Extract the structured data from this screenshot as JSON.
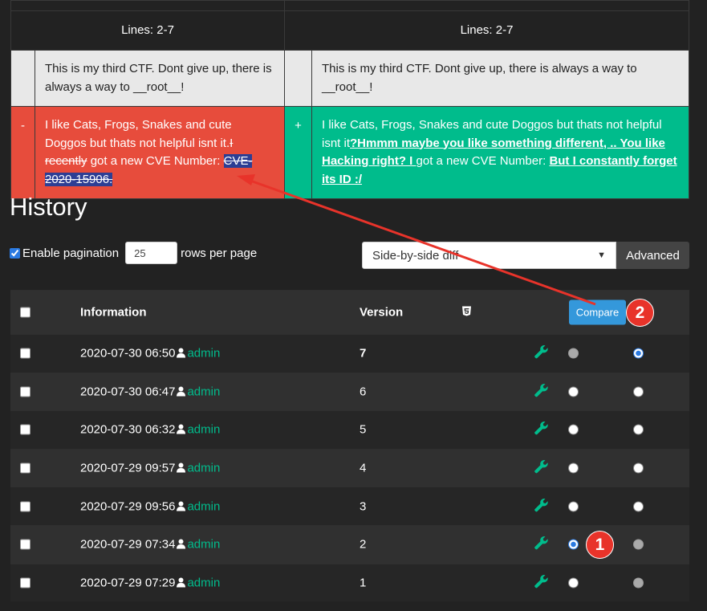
{
  "diff": {
    "lines_left": "Lines: 2-7",
    "lines_right": "Lines: 2-7",
    "context_left": "This is my third CTF. Dont give up, there is always a way to __root__!",
    "context_right": "This is my third CTF. Dont give up, there is always a way to __root__!",
    "del_marker": "-",
    "ins_marker": "+",
    "del_text_1": "I like Cats, Frogs, Snakes and cute Doggos but thats not helpful isnt it.",
    "del_struck": "I recently",
    "del_text_2": " got a new CVE Number: ",
    "del_highlight": "CVE-2020-15906.",
    "ins_text_1": "I like Cats, Frogs, Snakes and cute Doggos but thats not helpful isnt it",
    "ins_added_1": "?Hmmm maybe you like something different, .. You like Hacking right? I ",
    "ins_text_2": "got a new CVE Number: ",
    "ins_added_2": "But I constantly forget its ID :/"
  },
  "history": {
    "title": "History",
    "enable_pagination": "Enable pagination",
    "rows_value": "25",
    "rows_per_page": "rows per page",
    "view_mode": "Side-by-side diff",
    "advanced": "Advanced",
    "columns": {
      "information": "Information",
      "version": "Version",
      "html_icon": "html5-icon"
    },
    "compare": "Compare",
    "rows": [
      {
        "date": "2020-07-30 06:50",
        "user": "admin",
        "version": "7",
        "r1": "disabled",
        "r2": "selected"
      },
      {
        "date": "2020-07-30 06:47",
        "user": "admin",
        "version": "6",
        "r1": "empty",
        "r2": "empty"
      },
      {
        "date": "2020-07-30 06:32",
        "user": "admin",
        "version": "5",
        "r1": "empty",
        "r2": "empty"
      },
      {
        "date": "2020-07-29 09:57",
        "user": "admin",
        "version": "4",
        "r1": "empty",
        "r2": "empty"
      },
      {
        "date": "2020-07-29 09:56",
        "user": "admin",
        "version": "3",
        "r1": "empty",
        "r2": "empty"
      },
      {
        "date": "2020-07-29 07:34",
        "user": "admin",
        "version": "2",
        "r1": "selected",
        "r2": "disabled"
      },
      {
        "date": "2020-07-29 07:29",
        "user": "admin",
        "version": "1",
        "r1": "empty",
        "r2": "disabled"
      }
    ]
  },
  "badges": {
    "one": "1",
    "two": "2"
  },
  "colors": {
    "delete": "#e74c3c",
    "insert": "#00bc8c",
    "accent": "#3498db",
    "annotation": "#e8332a"
  }
}
